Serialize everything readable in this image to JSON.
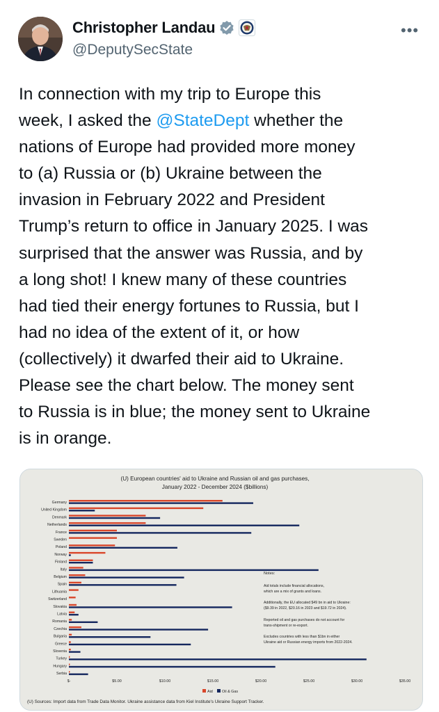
{
  "author": {
    "name": "Christopher Landau",
    "handle": "@DeputySecState",
    "verified_badge": "gray-check-badge-icon",
    "affiliate_badge": "state-dept-seal-icon"
  },
  "menu": {
    "more_icon": "more-dots-icon",
    "more_label": "•••"
  },
  "tweet": {
    "line1": "In connection with my trip to Europe this",
    "line2_pre": "week, I asked the ",
    "line2_mention": "@StateDept",
    "line2_post": " whether the",
    "line3": "nations of Europe had provided more money",
    "line4": "to (a) Russia or (b) Ukraine between the",
    "line5": "invasion in February 2022 and President",
    "line6": "Trump’s return to office in January 2025. I was",
    "line7": "surprised that the answer was Russia, and by",
    "line8": "a long shot! I knew many of these countries",
    "line9": "had tied their energy fortunes to Russia, but I",
    "line10": "had no idea of the extent of it, or how",
    "line11": "(collectively) it dwarfed their aid to Ukraine.",
    "line12": "Please see the chart below. The money sent",
    "line13": "to Russia is in blue; the money sent to Ukraine",
    "line14": "is in orange."
  },
  "colors": {
    "aid": "#d9462a",
    "oil_gas": "#14275e",
    "mention": "#1d9bf0"
  },
  "chart_data": {
    "type": "bar",
    "orientation": "horizontal",
    "title": "(U) European countries' aid to Ukraine and Russian oil and gas purchases,",
    "subtitle": "January 2022 - December 2024 ($billions)",
    "xlim": [
      0,
      35
    ],
    "x_ticks": [
      "$-",
      "$5.00",
      "$10.00",
      "$15.00",
      "$20.00",
      "$25.00",
      "$30.00",
      "$35.00"
    ],
    "grid": false,
    "legend_position": "bottom",
    "categories": [
      "Germany",
      "United Kingdom",
      "Denmark",
      "Netherlands",
      "France",
      "Sweden",
      "Poland",
      "Norway",
      "Finland",
      "Italy",
      "Belgium",
      "Spain",
      "Lithuania",
      "Switzerland",
      "Slovakia",
      "Latvia",
      "Romania",
      "Czechia",
      "Bulgaria",
      "Greece",
      "Slovenia",
      "Turkey",
      "Hungary",
      "Serbia"
    ],
    "series": [
      {
        "name": "Aid",
        "values": [
          16.0,
          14.0,
          8.0,
          8.0,
          5.0,
          5.0,
          4.8,
          3.8,
          2.5,
          1.5,
          1.7,
          1.3,
          1.0,
          0.7,
          0.8,
          0.6,
          0.3,
          1.3,
          0.3,
          0.2,
          0.2,
          0.1,
          0.1,
          0.1
        ]
      },
      {
        "name": "Oil & Gas",
        "values": [
          19.2,
          2.7,
          9.5,
          24.0,
          19.0,
          0.0,
          11.3,
          0.2,
          2.5,
          26.0,
          12.0,
          11.2,
          0.0,
          0.0,
          17.0,
          1.0,
          3.0,
          14.5,
          8.5,
          12.7,
          1.2,
          31.0,
          21.5,
          2.0
        ]
      }
    ],
    "notes": {
      "heading": "Notes:",
      "n1a": "Aid totals include financial allocations,",
      "n1b": "which are a mix of grants and loans.",
      "n2a": "Additionally, the EU allocated $49 bn in aid to Ukraine:",
      "n2b": "($9.39 in 2022, $20.16 in 2023 and $19.72 in 2024).",
      "n3a": "Reported oil and gas purchases do not account for",
      "n3b": "trans-shipment or re-export.",
      "n4a": "Excludes countries with less than $1bn in either",
      "n4b": "Ukraine aid or Russian energy imports from 2022-2024."
    },
    "sources": "(U) Sources:  Import data from Trade Data Monitor.  Ukraine assistance data from Kiel Institute's Ukraine Support Tracker."
  }
}
